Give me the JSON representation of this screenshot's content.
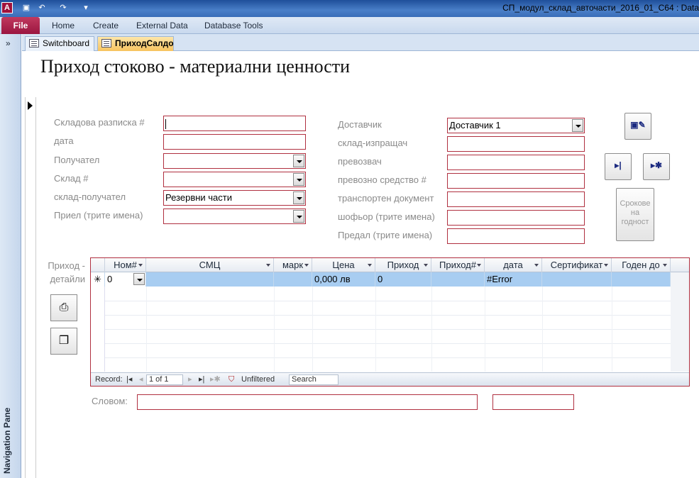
{
  "window": {
    "title": "СП_модул_склад_авточасти_2016_01_C64 : Data",
    "app_icon_letter": "A"
  },
  "ribbon": {
    "file": "File",
    "tabs": [
      "Home",
      "Create",
      "External Data",
      "Database Tools"
    ]
  },
  "nav_pane": {
    "label": "Navigation Pane",
    "toggle": "»"
  },
  "doc_tabs": [
    {
      "label": "Switchboard"
    },
    {
      "label": "ПриходСалдо"
    }
  ],
  "form": {
    "title": "Приход стоково - материални ценности",
    "fields_left": [
      {
        "label": "Складова разписка #",
        "value": ""
      },
      {
        "label": "дата",
        "value": ""
      },
      {
        "label": "Получател",
        "value": ""
      },
      {
        "label": "Склад #",
        "value": ""
      },
      {
        "label": "склад-получател",
        "value": "Резервни части"
      },
      {
        "label": "Приел (трите имена)",
        "value": ""
      }
    ],
    "fields_right": [
      {
        "label": "Доставчик",
        "value": "Доставчик 1"
      },
      {
        "label": "склад-изпращач",
        "value": ""
      },
      {
        "label": "превозвач",
        "value": ""
      },
      {
        "label": "превозно средство #",
        "value": ""
      },
      {
        "label": "транспортен документ",
        "value": ""
      },
      {
        "label": "шофьор (трите имена)",
        "value": ""
      },
      {
        "label": "Предал (трите имена)",
        "value": ""
      }
    ],
    "buttons": {
      "expiry": "Срокове на годност",
      "save_icon": "save-edit-icon",
      "next_icon": "next-record-icon",
      "new_icon": "new-record-icon"
    }
  },
  "subform": {
    "label": "Приход - детайли",
    "columns": [
      "Ном#",
      "СМЦ",
      "марк",
      "Цена",
      "Приход",
      "Приход#",
      "дата",
      "Сертификат",
      "Годен до"
    ],
    "new_row": {
      "marker": "✳",
      "nom": "0",
      "smc": "",
      "mark": "",
      "price": "0,000 лв",
      "income": "0",
      "income_no": "",
      "date": "#Error",
      "certificate": "",
      "valid_until": ""
    },
    "navigator": {
      "record_label": "Record:",
      "position": "1 of 1",
      "filter": "Unfiltered",
      "search": "Search"
    }
  },
  "footer": {
    "words_label": "Словом:",
    "words_value": "",
    "extra_value": ""
  }
}
